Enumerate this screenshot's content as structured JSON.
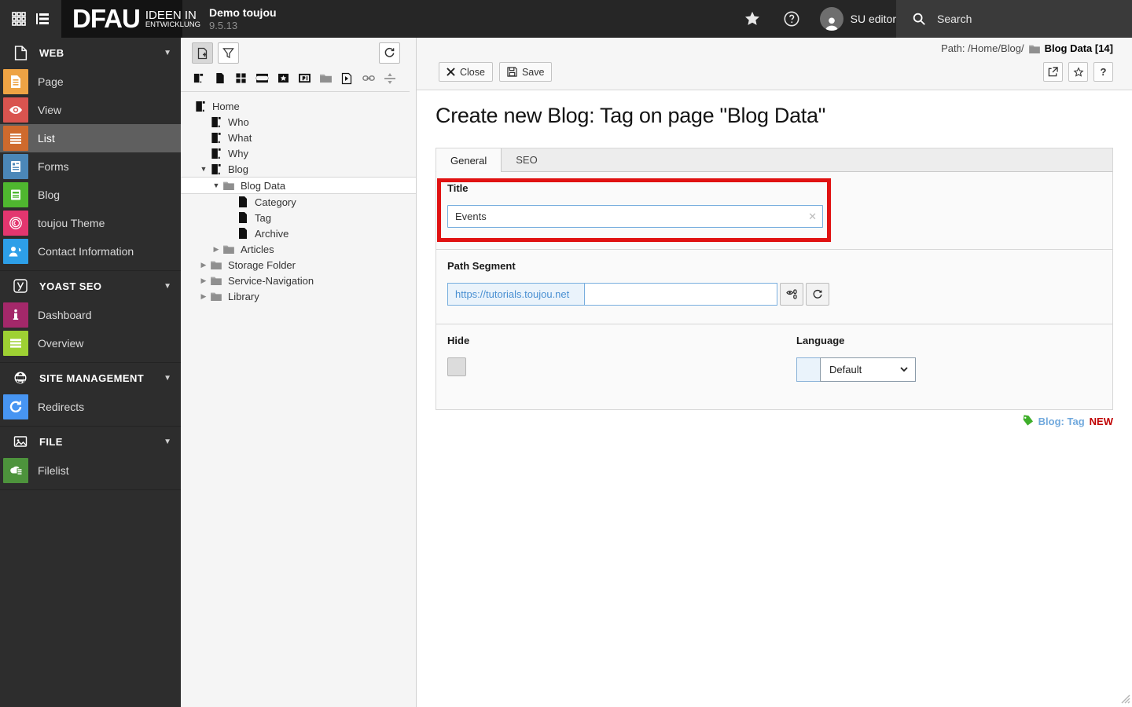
{
  "topbar": {
    "logo_text": "DFAU",
    "logo_claim_line1": "IDEEN IN",
    "logo_claim_line2": "ENTWICKLUNG",
    "site_name": "Demo toujou",
    "version": "9.5.13",
    "username": "SU editor",
    "search_label": "Search",
    "icons": [
      "modules-grid-icon",
      "pagetree-toggle-icon",
      "bookmark-star-icon",
      "help-icon",
      "avatar",
      "search-icon"
    ]
  },
  "module_menu": {
    "sections": [
      {
        "label": "WEB",
        "icon": "web-document-icon",
        "items": [
          {
            "label": "Page",
            "icon": "page-module-icon",
            "color": "#eea344"
          },
          {
            "label": "View",
            "icon": "view-eye-icon",
            "color": "#d9544f"
          },
          {
            "label": "List",
            "icon": "list-module-icon",
            "color": "#cf6a2d",
            "active": true
          },
          {
            "label": "Forms",
            "icon": "forms-module-icon",
            "color": "#4b87b8"
          },
          {
            "label": "Blog",
            "icon": "blog-module-icon",
            "color": "#4fb72f"
          },
          {
            "label": "toujou Theme",
            "icon": "fingerprint-icon",
            "color": "#e3366f"
          },
          {
            "label": "Contact Information",
            "icon": "contact-icon",
            "color": "#2d9fe8"
          }
        ]
      },
      {
        "label": "YOAST SEO",
        "icon": "yoast-icon",
        "items": [
          {
            "label": "Dashboard",
            "icon": "info-icon",
            "color": "#a4286a"
          },
          {
            "label": "Overview",
            "icon": "bars-icon",
            "color": "#9ed133"
          }
        ]
      },
      {
        "label": "SITE MANAGEMENT",
        "icon": "globe-icon",
        "items": [
          {
            "label": "Redirects",
            "icon": "redirect-arrow-icon",
            "color": "#4795f2"
          }
        ]
      },
      {
        "label": "FILE",
        "icon": "image-icon",
        "items": [
          {
            "label": "Filelist",
            "icon": "filelist-icon",
            "color": "#4d933c"
          }
        ]
      }
    ]
  },
  "pagetree": {
    "toolbar_icons": [
      "new-page-button",
      "filter-button",
      "refresh-button"
    ],
    "drag_icons": [
      "page-drag-icon",
      "blank-page-drag-icon",
      "shortcut-grid-drag-icon",
      "mountpoint-drag-icon",
      "special-star-drag-icon",
      "recycler-drag-icon",
      "folder-drag-icon",
      "shortcut-page-drag-icon",
      "external-link-drag-icon",
      "spacer-drag-icon"
    ],
    "nodes": [
      {
        "label": "Home"
      },
      {
        "label": "Who"
      },
      {
        "label": "What"
      },
      {
        "label": "Why"
      },
      {
        "label": "Blog"
      },
      {
        "label": "Blog Data"
      },
      {
        "label": "Category"
      },
      {
        "label": "Tag"
      },
      {
        "label": "Archive"
      },
      {
        "label": "Articles"
      },
      {
        "label": "Storage Folder"
      },
      {
        "label": "Service-Navigation"
      },
      {
        "label": "Library"
      }
    ]
  },
  "docheader": {
    "path_prefix": "Path: /Home/Blog/",
    "path_page": "Blog Data [14]",
    "close_label": "Close",
    "save_label": "Save",
    "icon_buttons": [
      "open-in-new-icon",
      "star-outline-icon",
      "help-question-icon"
    ]
  },
  "main": {
    "heading": "Create new Blog: Tag on page \"Blog Data\"",
    "tabs": [
      {
        "label": "General"
      },
      {
        "label": "SEO"
      }
    ],
    "fields": {
      "title": {
        "label": "Title",
        "value": "Events"
      },
      "path_segment": {
        "label": "Path Segment",
        "base_url": "https://tutorials.toujou.net",
        "value": ""
      },
      "hide": {
        "label": "Hide",
        "checked": false
      },
      "language": {
        "label": "Language",
        "selected": "Default"
      }
    },
    "annotation_color": "#e01212"
  },
  "footer_badge": {
    "record_type": "Blog: Tag",
    "status": "NEW"
  }
}
